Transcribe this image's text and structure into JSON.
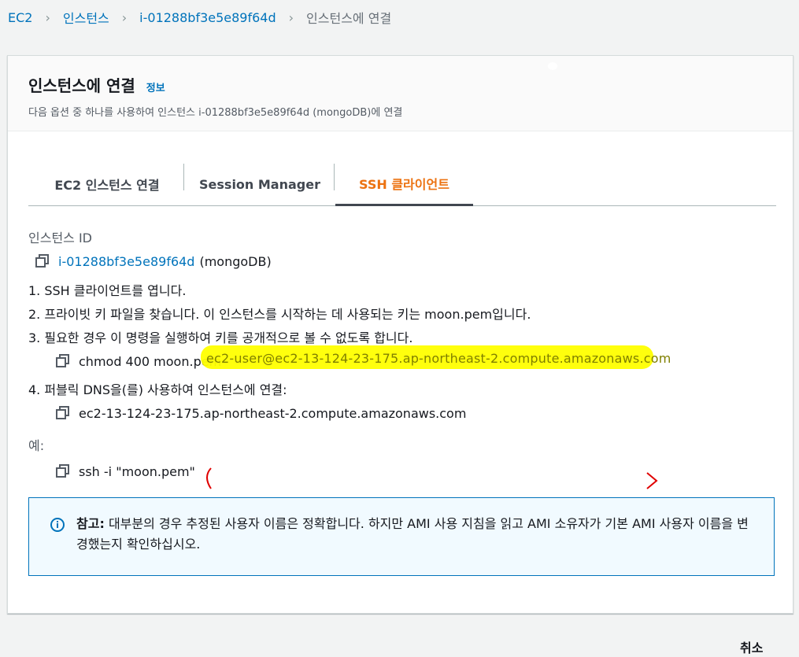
{
  "breadcrumb": {
    "items": [
      "EC2",
      "인스턴스",
      "i-01288bf3e5e89f64d"
    ],
    "current": "인스턴스에 연결"
  },
  "header": {
    "title": "인스턴스에 연결",
    "info_link": "정보",
    "description": "다음 옵션 중 하나를 사용하여 인스턴스 i-01288bf3e5e89f64d (mongoDB)에 연결"
  },
  "tabs": [
    {
      "label": "EC2 인스턴스 연결",
      "active": false
    },
    {
      "label": "Session Manager",
      "active": false
    },
    {
      "label": "SSH 클라이언트",
      "active": true
    }
  ],
  "content": {
    "instance_id_label": "인스턴스 ID",
    "instance_id": "i-01288bf3e5e89f64d",
    "instance_name": "(mongoDB)",
    "steps": [
      "1. SSH 클라이언트를 엽니다.",
      "2. 프라이빗 키 파일을 찾습니다. 이 인스턴스를 시작하는 데 사용되는 키는 moon.pem입니다.",
      "3. 필요한 경우 이 명령을 실행하여 키를 공개적으로 볼 수 없도록 합니다.",
      "4. 퍼블릭 DNS을(를) 사용하여 인스턴스에 연결:"
    ],
    "chmod_command": "chmod 400 moon.pem",
    "public_dns": "ec2-13-124-23-175.ap-northeast-2.compute.amazonaws.com",
    "example_label": "예:",
    "ssh_command_prefix": "ssh -i \"moon.pem\"",
    "ssh_command_redacted": "ec2-user@ec2-13-124-23-175.ap-northeast-2.compute.amazonaws.com"
  },
  "alert": {
    "title": "참고:",
    "text": "대부분의 경우 추정된 사용자 이름은 정확합니다. 하지만 AMI 사용 지침을 읽고 AMI 소유자가 기본 AMI 사용자 이름을 변경했는지 확인하십시오."
  },
  "footer": {
    "cancel_label": "취소"
  },
  "colors": {
    "link": "#0073bb",
    "active_tab": "#ec7211",
    "highlight": "#ffff00",
    "annotation": "#e00000"
  }
}
